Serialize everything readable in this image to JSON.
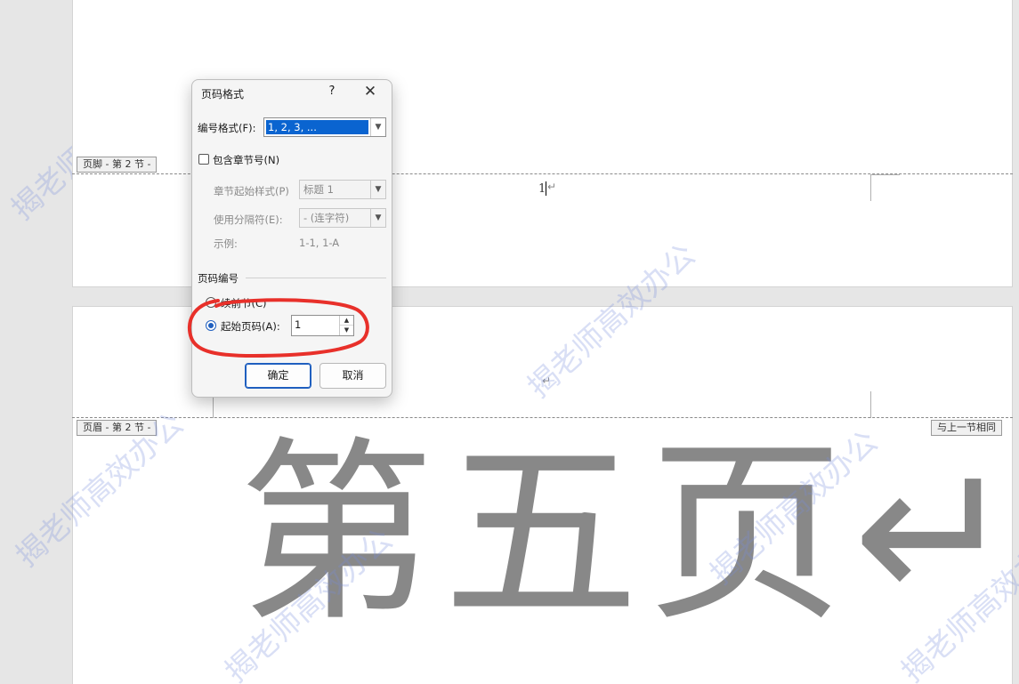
{
  "document": {
    "footer_tag": "页脚 - 第 2 节 -",
    "header_tag": "页眉 - 第 2 节 -",
    "same_as_previous": "与上一节相同",
    "footer_page_number": "1",
    "paragraph_mark": "↵",
    "big_text": "第五页↵",
    "watermark": "揭老师高效办公"
  },
  "dialog": {
    "title": "页码格式",
    "help": "?",
    "close": "✕",
    "number_format_label": "编号格式(F):",
    "number_format_value": "1, 2, 3, ...",
    "include_chapter_label": "包含章节号(N)",
    "chapter_style_label": "章节起始样式(P)",
    "chapter_style_value": "标题 1",
    "separator_label": "使用分隔符(E):",
    "separator_value": "-   (连字符)",
    "example_label": "示例:",
    "example_value": "1-1, 1-A",
    "numbering_group": "页码编号",
    "continue_label": "续前节(C)",
    "start_at_label": "起始页码(A):",
    "start_at_value": "1",
    "ok": "确定",
    "cancel": "取消"
  },
  "colors": {
    "accent": "#1f5fbf",
    "annotation": "#e8302a",
    "big_text": "#888888"
  }
}
